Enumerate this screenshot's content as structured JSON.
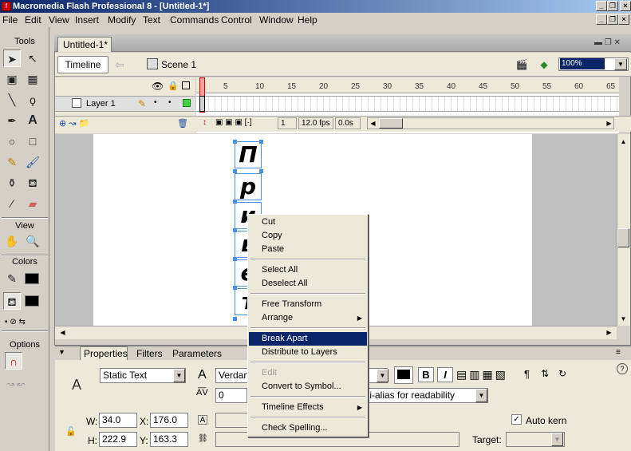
{
  "window": {
    "title": "Macromedia Flash Professional 8 - [Untitled-1*]"
  },
  "menubar": [
    "File",
    "Edit",
    "View",
    "Insert",
    "Modify",
    "Text",
    "Commands",
    "Control",
    "Window",
    "Help"
  ],
  "toolbox": {
    "tools_label": "Tools",
    "view_label": "View",
    "colors_label": "Colors",
    "options_label": "Options"
  },
  "document": {
    "tab": "Untitled-1*",
    "timeline_button": "Timeline",
    "scene": "Scene 1",
    "zoom": "100%"
  },
  "timeline": {
    "ruler": [
      "5",
      "10",
      "15",
      "20",
      "25",
      "30",
      "35",
      "40",
      "45",
      "50",
      "55",
      "60",
      "65"
    ],
    "layer_name": "Layer 1",
    "current_frame": "1",
    "fps": "12.0 fps",
    "elapsed": "0.0s"
  },
  "stage": {
    "letters": [
      "П",
      "р",
      "и",
      "в",
      "е",
      "т"
    ]
  },
  "properties": {
    "tabs": [
      "Properties",
      "Filters",
      "Parameters"
    ],
    "text_type": "Static Text",
    "font": "Verdan",
    "tracking": "0",
    "antialias": "ti-alias for readability",
    "w_label": "W:",
    "w": "34.0",
    "x_label": "X:",
    "x": "176.0",
    "h_label": "H:",
    "h": "222.9",
    "y_label": "Y:",
    "y": "163.3",
    "autokern": "Auto kern",
    "target_label": "Target:",
    "bold": "B",
    "italic": "I"
  },
  "context_menu": {
    "items": [
      {
        "label": "Cut"
      },
      {
        "label": "Copy"
      },
      {
        "label": "Paste"
      },
      {
        "label": "Select All"
      },
      {
        "label": "Deselect All"
      },
      {
        "label": "Free Transform"
      },
      {
        "label": "Arrange"
      },
      {
        "label": "Break Apart"
      },
      {
        "label": "Distribute to Layers"
      },
      {
        "label": "Edit"
      },
      {
        "label": "Convert to Symbol..."
      },
      {
        "label": "Timeline Effects"
      },
      {
        "label": "Check Spelling..."
      }
    ]
  }
}
